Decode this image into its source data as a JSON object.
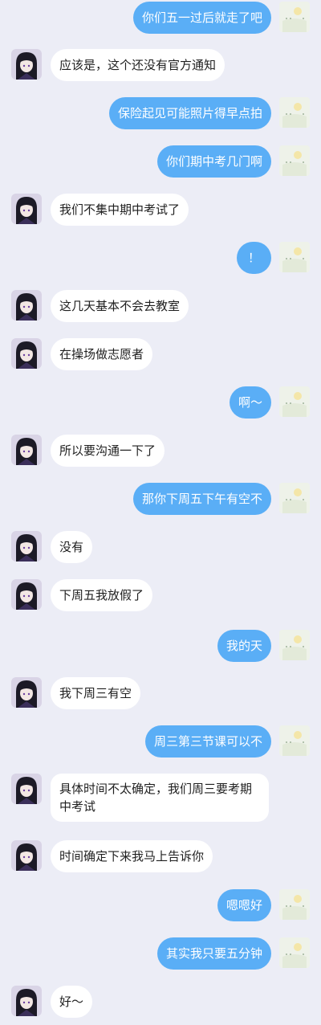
{
  "colors": {
    "background": "#ecedf6",
    "self_bubble": "#5aaef6",
    "self_text": "#ffffff",
    "other_bubble": "#ffffff",
    "other_text": "#1f1f1f"
  },
  "messages": [
    {
      "sender": "self",
      "text": "你们五一过后就走了吧"
    },
    {
      "sender": "other",
      "text": "应该是，这个还没有官方通知"
    },
    {
      "sender": "self",
      "text": "保险起见可能照片得早点拍"
    },
    {
      "sender": "self",
      "text": "你们期中考几门啊"
    },
    {
      "sender": "other",
      "text": "我们不集中期中考试了"
    },
    {
      "sender": "self",
      "text": "！"
    },
    {
      "sender": "other",
      "text": "这几天基本不会去教室"
    },
    {
      "sender": "other",
      "text": "在操场做志愿者"
    },
    {
      "sender": "self",
      "text": "啊～"
    },
    {
      "sender": "other",
      "text": "所以要沟通一下了"
    },
    {
      "sender": "self",
      "text": "那你下周五下午有空不"
    },
    {
      "sender": "other",
      "text": "没有"
    },
    {
      "sender": "other",
      "text": "下周五我放假了"
    },
    {
      "sender": "self",
      "text": "我的天"
    },
    {
      "sender": "other",
      "text": "我下周三有空"
    },
    {
      "sender": "self",
      "text": "周三第三节课可以不"
    },
    {
      "sender": "other",
      "text": "具体时间不太确定，我们周三要考期中考试"
    },
    {
      "sender": "other",
      "text": "时间确定下来我马上告诉你"
    },
    {
      "sender": "self",
      "text": "嗯嗯好"
    },
    {
      "sender": "self",
      "text": "其实我只要五分钟"
    },
    {
      "sender": "other",
      "text": "好～"
    }
  ]
}
